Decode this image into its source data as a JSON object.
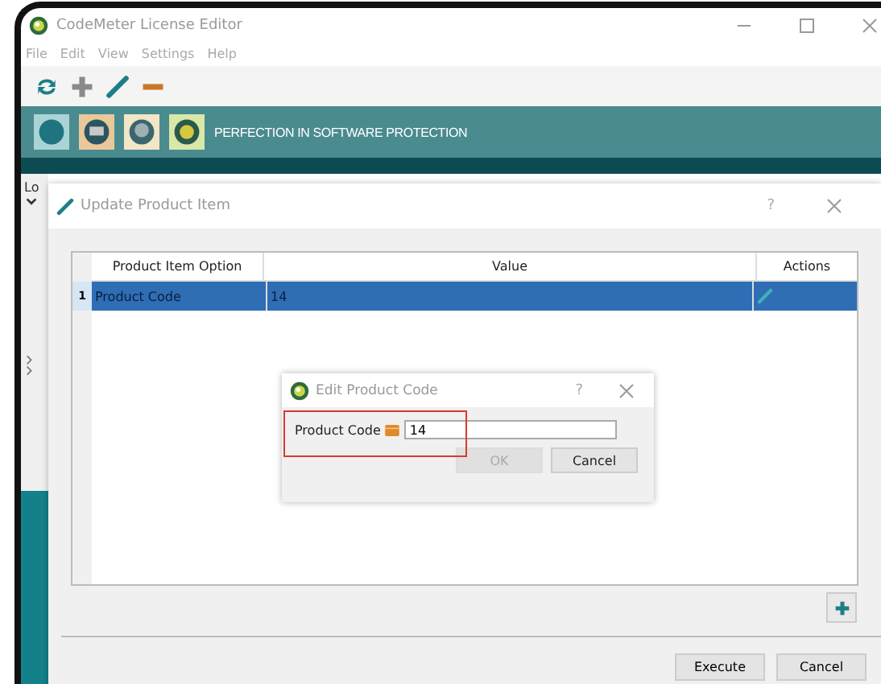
{
  "window": {
    "title": "CodeMeter License Editor"
  },
  "menu": [
    "File",
    "Edit",
    "View",
    "Settings",
    "Help"
  ],
  "banner": {
    "slogan": "PERFECTION IN SOFTWARE PROTECTION"
  },
  "side_panel": {
    "label": "Lo"
  },
  "update_dialog": {
    "title": "Update Product Item",
    "help": "?",
    "columns": [
      "Product Item Option",
      "Value",
      "Actions"
    ],
    "rows": [
      {
        "number": "1",
        "option": "Product Code",
        "value": "14",
        "selected": true
      }
    ],
    "buttons": [
      "Execute",
      "Cancel"
    ]
  },
  "edit_dialog": {
    "title": "Edit Product Code",
    "help": "?",
    "label": "Product Code",
    "value": "14",
    "buttons": [
      {
        "label": "OK",
        "disabled": true
      },
      {
        "label": "Cancel",
        "disabled": false
      }
    ]
  }
}
